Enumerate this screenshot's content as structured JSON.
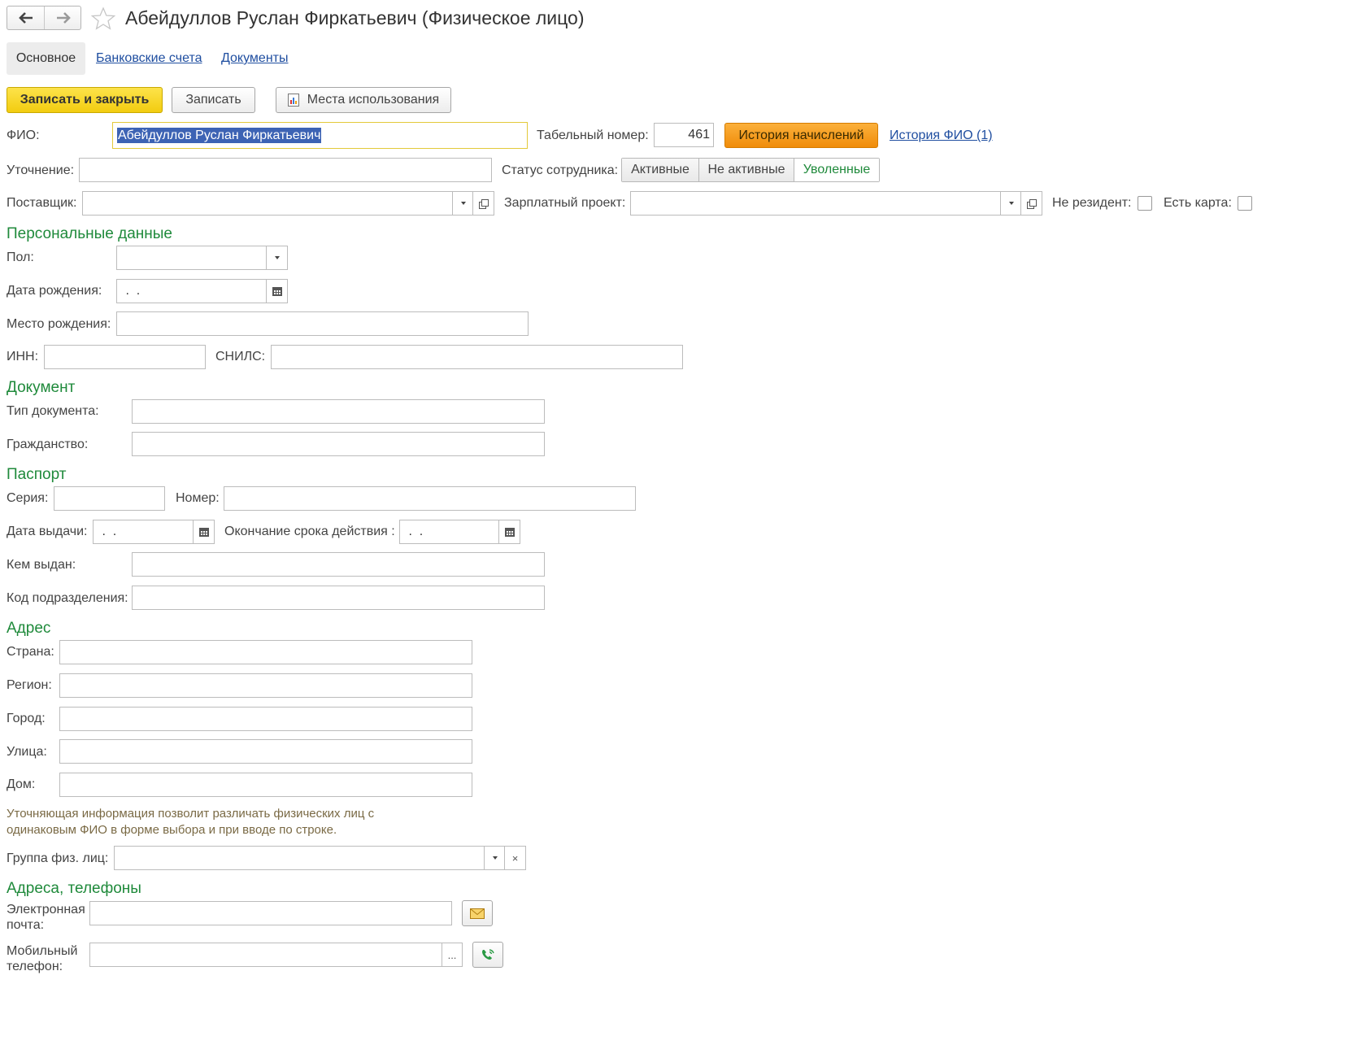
{
  "title": "Абейдуллов Руслан Фиркатьевич (Физическое лицо)",
  "tabs": [
    {
      "label": "Основное"
    },
    {
      "label": "Банковские счета"
    },
    {
      "label": "Документы"
    }
  ],
  "toolbar": {
    "save_close": "Записать и закрыть",
    "save": "Записать",
    "usages": "Места использования"
  },
  "fio": {
    "label": "ФИО:",
    "value": "Абейдуллов Руслан Фиркатьевич"
  },
  "tabel": {
    "label": "Табельный номер:",
    "value": "461"
  },
  "history_accruals": "История начислений",
  "history_fio": "История ФИО (1)",
  "clarification": {
    "label": "Уточнение:",
    "value": ""
  },
  "status": {
    "label": "Статус сотрудника:",
    "options": [
      "Активные",
      "Не активные",
      "Уволенные"
    ],
    "selected": "Уволенные"
  },
  "supplier": {
    "label": "Поставщик:",
    "value": ""
  },
  "salary_project": {
    "label": "Зарплатный проект:",
    "value": ""
  },
  "nonresident": {
    "label": "Не резидент:",
    "checked": false
  },
  "has_card": {
    "label": "Есть карта:",
    "checked": false
  },
  "personal": {
    "title": "Персональные данные",
    "gender": {
      "label": "Пол:",
      "value": ""
    },
    "birth_date": {
      "label": "Дата рождения:",
      "value": " .  ."
    },
    "birth_place": {
      "label": "Место рождения:",
      "value": ""
    },
    "inn": {
      "label": "ИНН:",
      "value": ""
    },
    "snils": {
      "label": "СНИЛС:",
      "value": ""
    }
  },
  "document": {
    "title": "Документ",
    "doc_type": {
      "label": "Тип документа:",
      "value": ""
    },
    "citizenship": {
      "label": "Гражданство:",
      "value": ""
    }
  },
  "passport": {
    "title": "Паспорт",
    "series": {
      "label": "Серия:",
      "value": ""
    },
    "number": {
      "label": "Номер:",
      "value": ""
    },
    "issue_date": {
      "label": "Дата выдачи:",
      "value": " .  ."
    },
    "expiry_date": {
      "label": "Окончание срока действия :",
      "value": " .  ."
    },
    "issued_by": {
      "label": "Кем выдан:",
      "value": ""
    },
    "division_code": {
      "label": "Код подразделения:",
      "value": ""
    }
  },
  "address": {
    "title": "Адрес",
    "country": {
      "label": "Страна:",
      "value": ""
    },
    "region": {
      "label": "Регион:",
      "value": ""
    },
    "city": {
      "label": "Город:",
      "value": ""
    },
    "street": {
      "label": "Улица:",
      "value": ""
    },
    "house": {
      "label": "Дом:",
      "value": ""
    }
  },
  "hint": {
    "line1": "Уточняющая информация позволит различать физических лиц  с",
    "line2": "одинаковым ФИО в форме выбора и при вводе по строке."
  },
  "group": {
    "label": "Группа физ. лиц:",
    "value": ""
  },
  "contacts": {
    "title": "Адреса, телефоны",
    "email": {
      "label_line1": "Электронная",
      "label_line2": "почта:",
      "value": ""
    },
    "mobile": {
      "label_line1": "Мобильный",
      "label_line2": "телефон:",
      "value": "",
      "more": "..."
    }
  },
  "colors": {
    "accent_green": "#1f8a3b",
    "primary_button": "#f5d51a",
    "orange_button": "#f39a0f",
    "link": "#1f4ea0"
  }
}
